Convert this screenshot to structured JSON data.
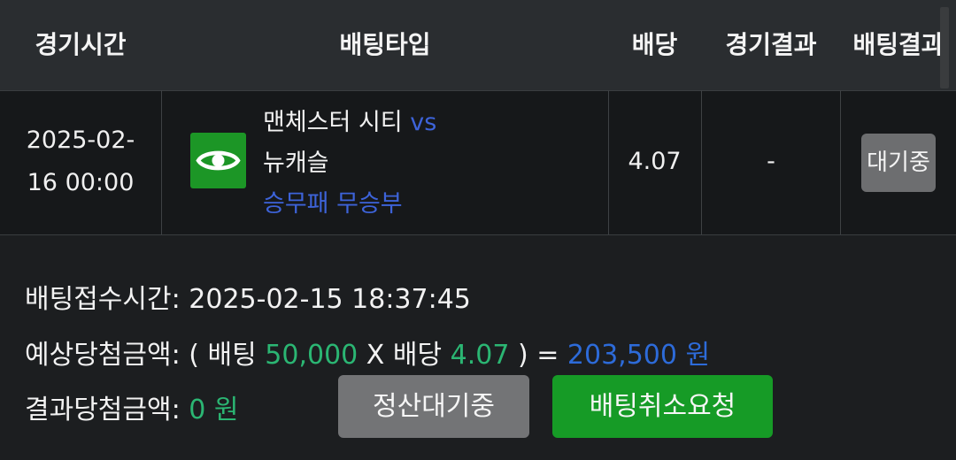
{
  "header": {
    "col_time": "경기시간",
    "col_bettype": "배팅타입",
    "col_odds": "배당",
    "col_game_result": "경기결과",
    "col_bet_result": "배팅결과"
  },
  "row": {
    "game_time_line1": "2025-02-",
    "game_time_line2": "16 00:00",
    "home_team": "맨체스터 시티",
    "vs": "vs",
    "away_team": "뉴캐슬",
    "bet_type": "승무패 무승부",
    "odds": "4.07",
    "game_result": "-",
    "bet_status": "대기중",
    "view_icon": "eye-icon"
  },
  "summary": {
    "accepted_label": "배팅접수시간:",
    "accepted_time": "2025-02-15 18:37:45",
    "expected_label": "예상당첨금액:",
    "open_paren": "( 배팅",
    "stake": "50,000",
    "times_label": "X 배당",
    "odds": "4.07",
    "close_eq": ") =",
    "expected_amount": "203,500 원",
    "result_label": "결과당첨금액:",
    "result_amount": "0 원"
  },
  "buttons": {
    "settle_pending": "정산대기중",
    "cancel_request": "배팅취소요청"
  },
  "colors": {
    "background": "#1c1e20",
    "header_bg": "#2a2d30",
    "accent_green": "#169b26",
    "amount_green": "#2bb673",
    "accent_blue": "#3d63d9",
    "badge_gray": "#6d6e70"
  }
}
